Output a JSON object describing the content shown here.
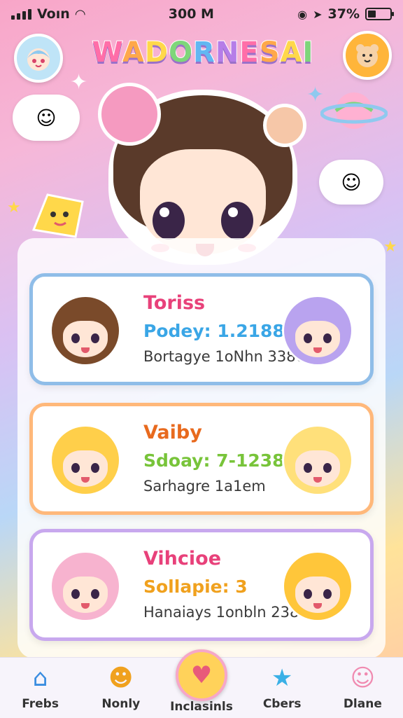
{
  "status_bar": {
    "carrier": "Voın",
    "time": "300 M",
    "battery": "37%",
    "battery_level": 0.37
  },
  "header": {
    "app_title": "WADORNESAI",
    "left_avatar_icon": "chibi-face-icon",
    "right_avatar_icon": "chibi-bear-icon"
  },
  "cards": [
    {
      "name": "Toriss",
      "stat": "Podey: 1.2188",
      "desc": "Bortagye 1oNhn 3386",
      "name_color": "#e8417a",
      "stat_color": "#3aa6e6",
      "border_color": "#8fbde8",
      "left_hair": "#7a4a2a",
      "right_hair": "#b9a3ef"
    },
    {
      "name": "Vaiby",
      "stat": "Sdoay: 7-1238",
      "desc": "Sarhagre 1a1em",
      "name_color": "#e86a1e",
      "stat_color": "#78c43a",
      "border_color": "#ffb87a",
      "left_hair": "#ffcf4a",
      "right_hair": "#ffe07a"
    },
    {
      "name": "Vihcioe",
      "stat": "Sollapie: 3",
      "desc": "Hanaiays 1onbln 2382",
      "name_color": "#e8417a",
      "stat_color": "#f0a11e",
      "border_color": "#c8a8ee",
      "left_hair": "#f7b3cf",
      "right_hair": "#ffc63a"
    }
  ],
  "tabs": [
    {
      "label": "Frebs",
      "icon": "home-icon"
    },
    {
      "label": "Nonly",
      "icon": "chibi-friends-icon"
    },
    {
      "label": "Inclasinls",
      "icon": "heart-icon"
    },
    {
      "label": "Cbers",
      "icon": "star-icon"
    },
    {
      "label": "Dlane",
      "icon": "blob-face-icon"
    }
  ],
  "active_tab": 2,
  "colors": {
    "accent_pink": "#f59ac0",
    "accent_yellow": "#ffd25a"
  }
}
